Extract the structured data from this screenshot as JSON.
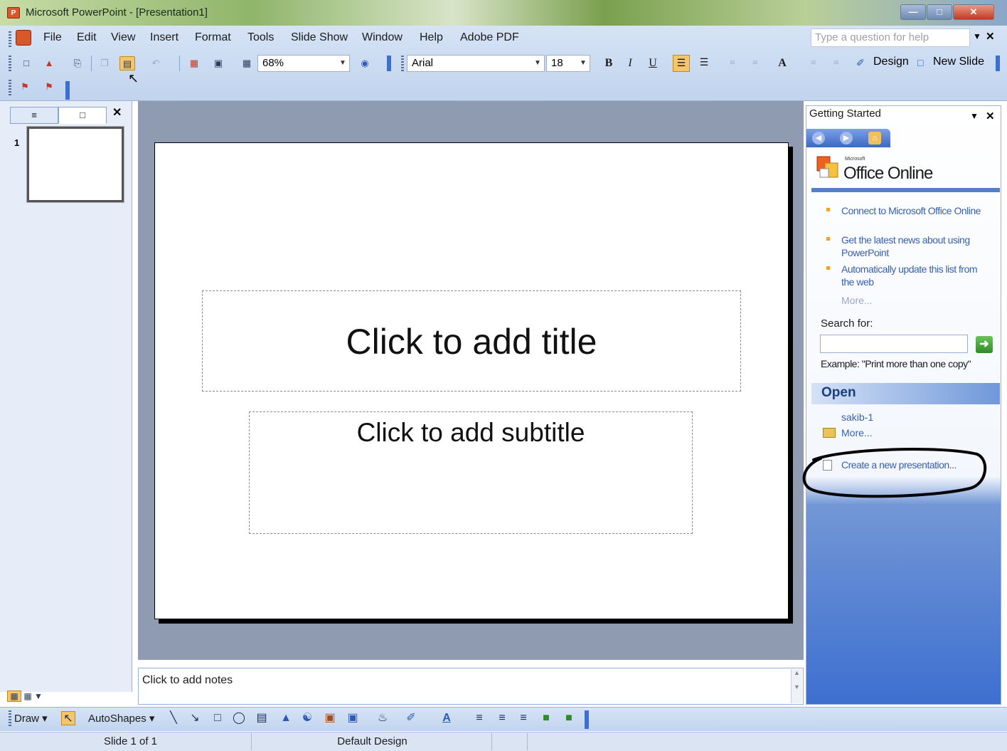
{
  "window": {
    "title": "Microsoft PowerPoint - [Presentation1]",
    "app_icon": "powerpoint-icon",
    "controls": [
      "minimize",
      "maximize",
      "close"
    ]
  },
  "menu": {
    "items": [
      "File",
      "Edit",
      "View",
      "Insert",
      "Format",
      "Tools",
      "Slide Show",
      "Window",
      "Help",
      "Adobe PDF"
    ],
    "help_placeholder": "Type a question for help"
  },
  "toolbar": {
    "zoom": "68%",
    "font": "Arial",
    "font_size": "18",
    "bold": "B",
    "italic": "I",
    "underline": "U",
    "grow_font": "A",
    "design_label": "Design",
    "new_slide_label": "New Slide"
  },
  "slides_pane": {
    "thumbnail_number": "1"
  },
  "slide": {
    "title_placeholder": "Click to add title",
    "subtitle_placeholder": "Click to add subtitle"
  },
  "notes": {
    "placeholder": "Click to add notes"
  },
  "task_pane": {
    "title": "Getting Started",
    "brand_small": "Microsoft",
    "brand": "Office Online",
    "links": [
      "Connect to Microsoft Office Online",
      "Get the latest news about using PowerPoint",
      "Automatically update this list from the web"
    ],
    "more": "More...",
    "search_label": "Search for:",
    "search_value": "",
    "search_example": "Example:  \"Print more than one copy\"",
    "open_header": "Open",
    "recent_file": "sakib-1",
    "open_more": "More...",
    "create_new": "Create a new presentation..."
  },
  "drawing_toolbar": {
    "draw": "Draw",
    "autoshapes": "AutoShapes"
  },
  "status_bar": {
    "slide_info": "Slide 1 of 1",
    "design": "Default Design"
  },
  "colors": {
    "accent": "#3d6fd0",
    "link": "#3760b0",
    "annotation": "#000000"
  }
}
